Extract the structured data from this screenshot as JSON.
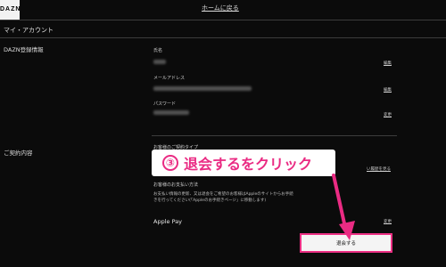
{
  "header": {
    "logo": "DAZN",
    "home_link": "ホームに戻る"
  },
  "page_title": "マイ・アカウント",
  "account": {
    "section_title": "DAZN登録情報",
    "name_label": "氏名",
    "email_label": "メールアドレス",
    "password_label": "パスワード",
    "edit_label": "編集",
    "change_label": "変更"
  },
  "contract": {
    "section_title": "ご契約内容",
    "type_label": "お客様のご契約タイプ",
    "history_link_partial": "い履歴を見る",
    "payment_label": "お客様のお支払い方法",
    "payment_note": "お支払い情報の更新、又は退会をご希望のお客様はAppleのサイトからお手続きを行ってください(「Appleのお手続きページ」に移動します)",
    "payment_method": "Apple Pay",
    "change_label": "変更",
    "cancel_button": "退会する"
  },
  "annotation": {
    "number": "③",
    "text": "退会するをクリック"
  },
  "colors": {
    "accent": "#ea2b83",
    "background": "#0b0b0b"
  }
}
